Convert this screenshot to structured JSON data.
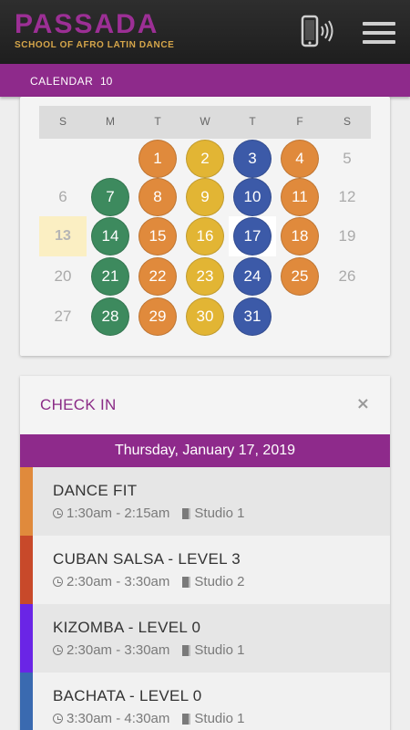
{
  "header": {
    "logo_word": "PASSADA",
    "logo_sub": "SCHOOL OF AFRO LATIN DANCE",
    "subbar_label": "CALENDAR",
    "subbar_count": "10"
  },
  "calendar": {
    "days_of_week": [
      "S",
      "M",
      "T",
      "W",
      "T",
      "F",
      "S"
    ],
    "today": "13",
    "selected": "17",
    "colors": {
      "green": "#3d8a5e",
      "orange": "#e08a3c",
      "yellow": "#e2b534",
      "blue": "#3c5aa8"
    },
    "weeks": [
      [
        null,
        null,
        {
          "d": "1",
          "c": "orange"
        },
        {
          "d": "2",
          "c": "yellow"
        },
        {
          "d": "3",
          "c": "blue"
        },
        {
          "d": "4",
          "c": "orange"
        },
        {
          "d": "5"
        }
      ],
      [
        {
          "d": "6"
        },
        {
          "d": "7",
          "c": "green"
        },
        {
          "d": "8",
          "c": "orange"
        },
        {
          "d": "9",
          "c": "yellow"
        },
        {
          "d": "10",
          "c": "blue"
        },
        {
          "d": "11",
          "c": "orange"
        },
        {
          "d": "12"
        }
      ],
      [
        {
          "d": "13",
          "today": true
        },
        {
          "d": "14",
          "c": "green"
        },
        {
          "d": "15",
          "c": "orange"
        },
        {
          "d": "16",
          "c": "yellow"
        },
        {
          "d": "17",
          "c": "blue",
          "selected": true
        },
        {
          "d": "18",
          "c": "orange"
        },
        {
          "d": "19"
        }
      ],
      [
        {
          "d": "20"
        },
        {
          "d": "21",
          "c": "green"
        },
        {
          "d": "22",
          "c": "orange"
        },
        {
          "d": "23",
          "c": "yellow"
        },
        {
          "d": "24",
          "c": "blue"
        },
        {
          "d": "25",
          "c": "orange"
        },
        {
          "d": "26"
        }
      ],
      [
        {
          "d": "27"
        },
        {
          "d": "28",
          "c": "green"
        },
        {
          "d": "29",
          "c": "orange"
        },
        {
          "d": "30",
          "c": "yellow"
        },
        {
          "d": "31",
          "c": "blue"
        },
        null,
        null
      ]
    ]
  },
  "checkin": {
    "title": "CHECK IN",
    "close": "×",
    "date": "Thursday, January 17, 2019",
    "classes": [
      {
        "name": "DANCE FIT",
        "time": "1:30am - 2:15am",
        "room": "Studio 1",
        "color": "#e08a3c",
        "bg": "#e6e6e6"
      },
      {
        "name": "CUBAN SALSA - LEVEL 3",
        "time": "2:30am - 3:30am",
        "room": "Studio 2",
        "color": "#c8492a",
        "bg": "#f1f1f1"
      },
      {
        "name": "KIZOMBA - LEVEL 0",
        "time": "2:30am - 3:30am",
        "room": "Studio 1",
        "color": "#6a25e6",
        "bg": "#e6e6e6"
      },
      {
        "name": "BACHATA - LEVEL 0",
        "time": "3:30am - 4:30am",
        "room": "Studio 1",
        "color": "#3a6ab0",
        "bg": "#f1f1f1"
      }
    ]
  }
}
